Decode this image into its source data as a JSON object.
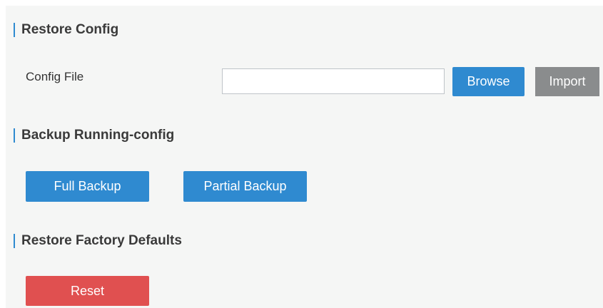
{
  "restore_config": {
    "title": "Restore Config",
    "config_file_label": "Config File",
    "config_file_value": "",
    "browse_label": "Browse",
    "import_label": "Import"
  },
  "backup": {
    "title": "Backup Running-config",
    "full_backup_label": "Full Backup",
    "partial_backup_label": "Partial Backup"
  },
  "factory": {
    "title": "Restore Factory Defaults",
    "reset_label": "Reset"
  },
  "colors": {
    "accent_blue": "#2f8ad0",
    "import_gray": "#8a8c8d",
    "reset_red": "#e05050",
    "panel_bg": "#f5f6f5"
  }
}
